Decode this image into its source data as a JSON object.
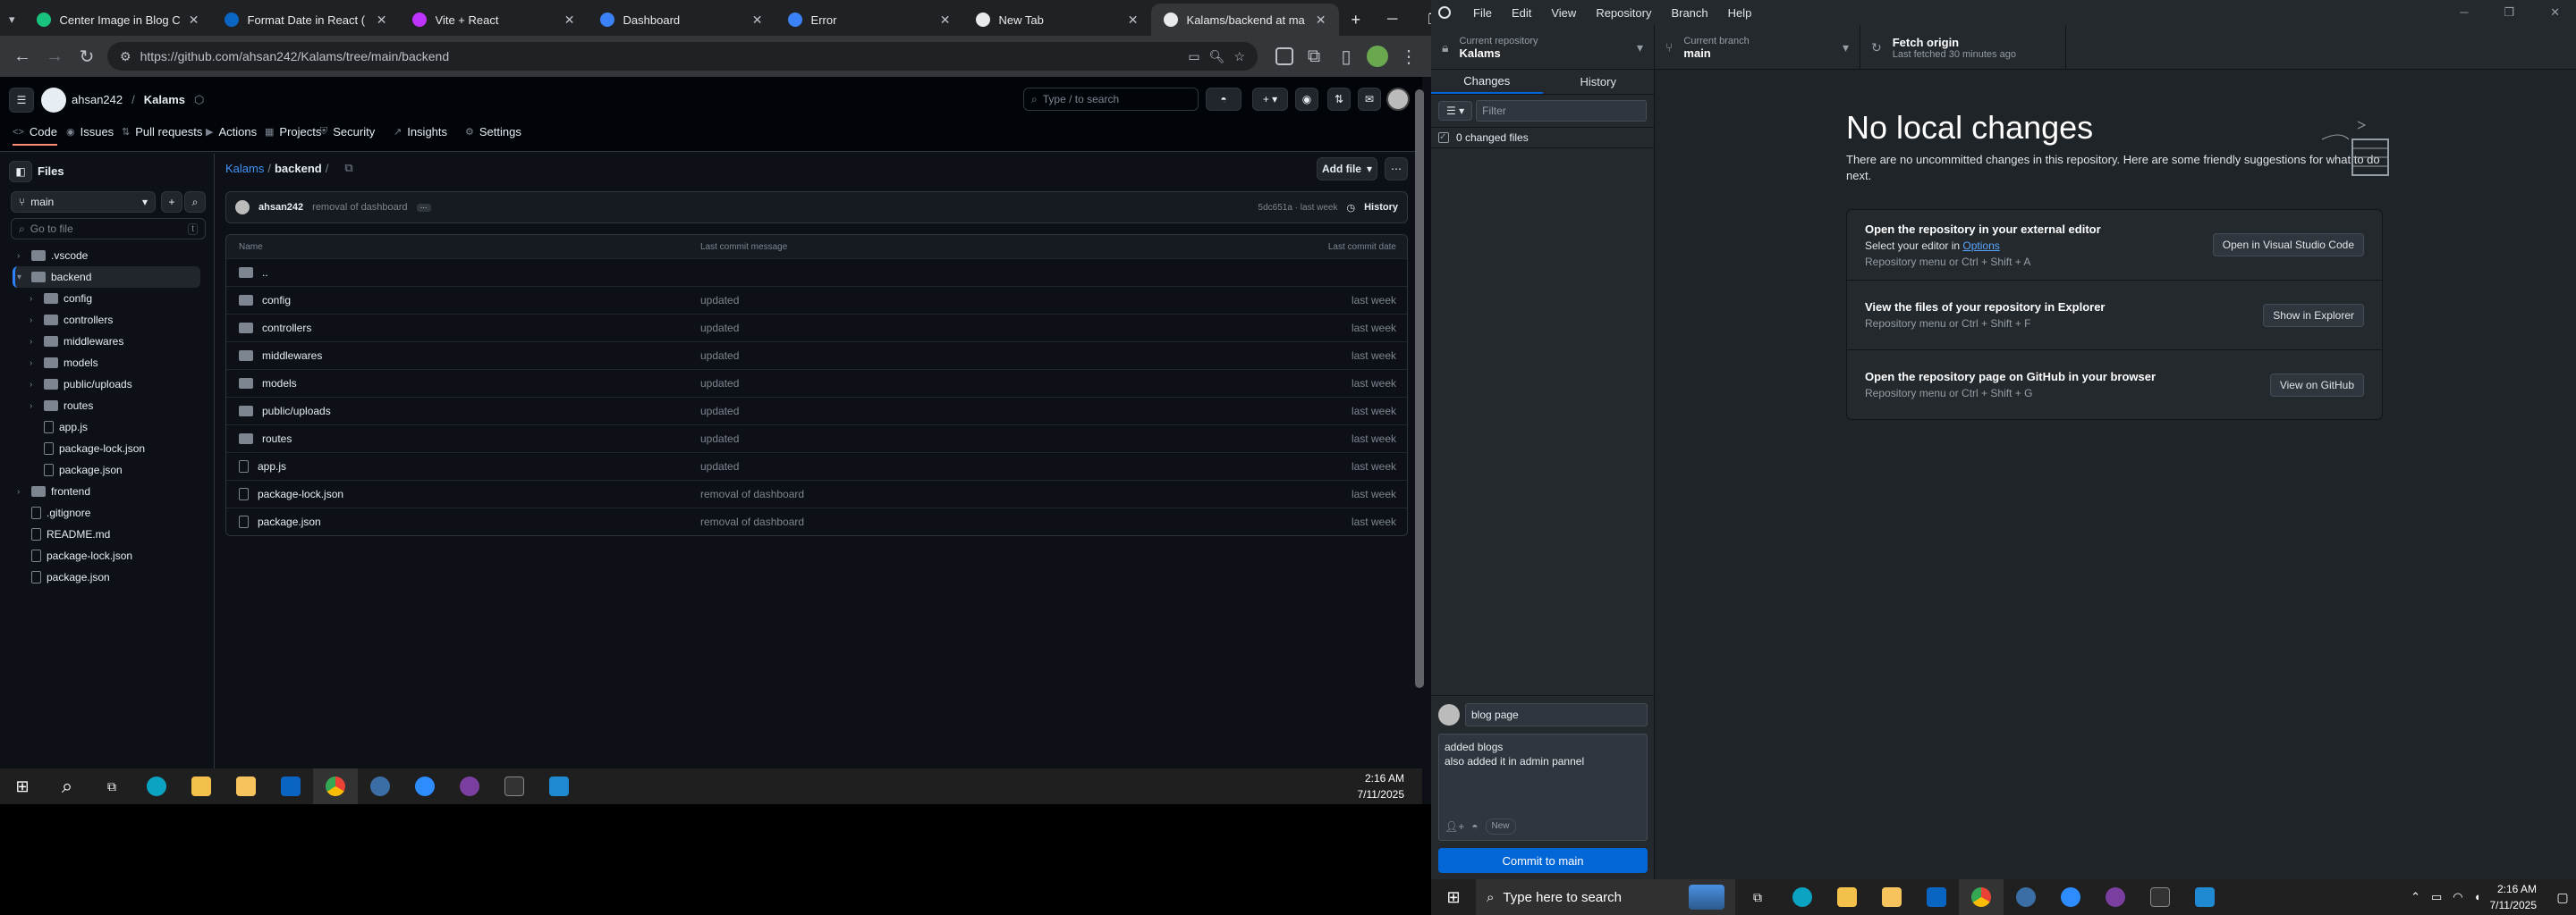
{
  "browser": {
    "tabs": [
      {
        "title": "Center Image in Blog C",
        "color": "#19c37d",
        "active": false
      },
      {
        "title": "Format Date in React (",
        "color": "#0b66c3",
        "active": false
      },
      {
        "title": "Vite + React",
        "color": "#bd34fe",
        "active": false
      },
      {
        "title": "Dashboard",
        "color": "#3b82f6",
        "active": false
      },
      {
        "title": "Error",
        "color": "#3b82f6",
        "active": false
      },
      {
        "title": "New Tab",
        "color": "#e8eaed",
        "active": false
      },
      {
        "title": "Kalams/backend at ma",
        "color": "#e8eaed",
        "active": true
      }
    ],
    "url": "https://github.com/ahsan242/Kalams/tree/main/backend"
  },
  "github": {
    "owner": "ahsan242",
    "repo": "Kalams",
    "search_placeholder": "Type / to search",
    "nav_tabs": [
      "Code",
      "Issues",
      "Pull requests",
      "Actions",
      "Projects",
      "Security",
      "Insights",
      "Settings"
    ],
    "sidebar": {
      "title": "Files",
      "branch": "main",
      "goto_placeholder": "Go to file",
      "tree": [
        {
          "name": ".vscode",
          "type": "dir",
          "depth": 0,
          "selected": false
        },
        {
          "name": "backend",
          "type": "dir-open",
          "depth": 0,
          "selected": true
        },
        {
          "name": "config",
          "type": "dir",
          "depth": 1,
          "selected": false
        },
        {
          "name": "controllers",
          "type": "dir",
          "depth": 1,
          "selected": false
        },
        {
          "name": "middlewares",
          "type": "dir",
          "depth": 1,
          "selected": false
        },
        {
          "name": "models",
          "type": "dir",
          "depth": 1,
          "selected": false
        },
        {
          "name": "public/uploads",
          "type": "dir",
          "depth": 1,
          "selected": false
        },
        {
          "name": "routes",
          "type": "dir",
          "depth": 1,
          "selected": false
        },
        {
          "name": "app.js",
          "type": "file",
          "depth": 1,
          "selected": false
        },
        {
          "name": "package-lock.json",
          "type": "file",
          "depth": 1,
          "selected": false
        },
        {
          "name": "package.json",
          "type": "file",
          "depth": 1,
          "selected": false
        },
        {
          "name": "frontend",
          "type": "dir",
          "depth": 0,
          "selected": false
        },
        {
          "name": ".gitignore",
          "type": "file",
          "depth": 0,
          "selected": false
        },
        {
          "name": "README.md",
          "type": "file",
          "depth": 0,
          "selected": false
        },
        {
          "name": "package-lock.json",
          "type": "file",
          "depth": 0,
          "selected": false
        },
        {
          "name": "package.json",
          "type": "file",
          "depth": 0,
          "selected": false
        }
      ]
    },
    "breadcrumb": {
      "repo": "Kalams",
      "dir": "backend",
      "sep": "/"
    },
    "add_file": "Add file",
    "commit_bar": {
      "author": "ahsan242",
      "message": "removal of dashboard",
      "sha_time": "5dc651a · last week",
      "history": "History"
    },
    "table": {
      "headers": [
        "Name",
        "Last commit message",
        "Last commit date"
      ],
      "rows": [
        {
          "name": "..",
          "type": "dir",
          "msg": "",
          "date": ""
        },
        {
          "name": "config",
          "type": "dir",
          "msg": "updated",
          "date": "last week"
        },
        {
          "name": "controllers",
          "type": "dir",
          "msg": "updated",
          "date": "last week"
        },
        {
          "name": "middlewares",
          "type": "dir",
          "msg": "updated",
          "date": "last week"
        },
        {
          "name": "models",
          "type": "dir",
          "msg": "updated",
          "date": "last week"
        },
        {
          "name": "public/uploads",
          "type": "dir",
          "msg": "updated",
          "date": "last week"
        },
        {
          "name": "routes",
          "type": "dir",
          "msg": "updated",
          "date": "last week"
        },
        {
          "name": "app.js",
          "type": "file",
          "msg": "updated",
          "date": "last week"
        },
        {
          "name": "package-lock.json",
          "type": "file",
          "msg": "removal of dashboard",
          "date": "last week"
        },
        {
          "name": "package.json",
          "type": "file",
          "msg": "removal of dashboard",
          "date": "last week"
        }
      ]
    }
  },
  "taskbar_left": {
    "time": "2:16 AM",
    "date": "7/11/2025"
  },
  "desktop": {
    "menu": [
      "File",
      "Edit",
      "View",
      "Repository",
      "Branch",
      "Help"
    ],
    "current_repo_label": "Current repository",
    "current_repo": "Kalams",
    "current_branch_label": "Current branch",
    "current_branch": "main",
    "fetch_label": "Fetch origin",
    "fetch_sub": "Last fetched 30 minutes ago",
    "tabs": [
      "Changes",
      "History"
    ],
    "filter_placeholder": "Filter",
    "changed_files": "0 changed files",
    "no_changes_title": "No local changes",
    "no_changes_desc": "There are no uncommitted changes in this repository. Here are some friendly suggestions for what to do next.",
    "suggestions": [
      {
        "title": "Open the repository in your external editor",
        "line2_prefix": "Select your editor in ",
        "line2_link": "Options",
        "line3": "Repository menu or  Ctrl + Shift + A",
        "button": "Open in Visual Studio Code"
      },
      {
        "title": "View the files of your repository in Explorer",
        "line2_prefix": "",
        "line2_link": "",
        "line3": "Repository menu or  Ctrl + Shift + F",
        "button": "Show in Explorer"
      },
      {
        "title": "Open the repository page on GitHub in your browser",
        "line2_prefix": "",
        "line2_link": "",
        "line3": "Repository menu or  Ctrl + Shift + G",
        "button": "View on GitHub"
      }
    ],
    "summary_value": "blog page",
    "description_lines": [
      "added blogs",
      "also added it in admin pannel"
    ],
    "new_badge": "New",
    "commit_button": "Commit to main"
  },
  "taskbar_right": {
    "search_placeholder": "Type here to search",
    "time": "2:16 AM",
    "date": "7/11/2025"
  }
}
